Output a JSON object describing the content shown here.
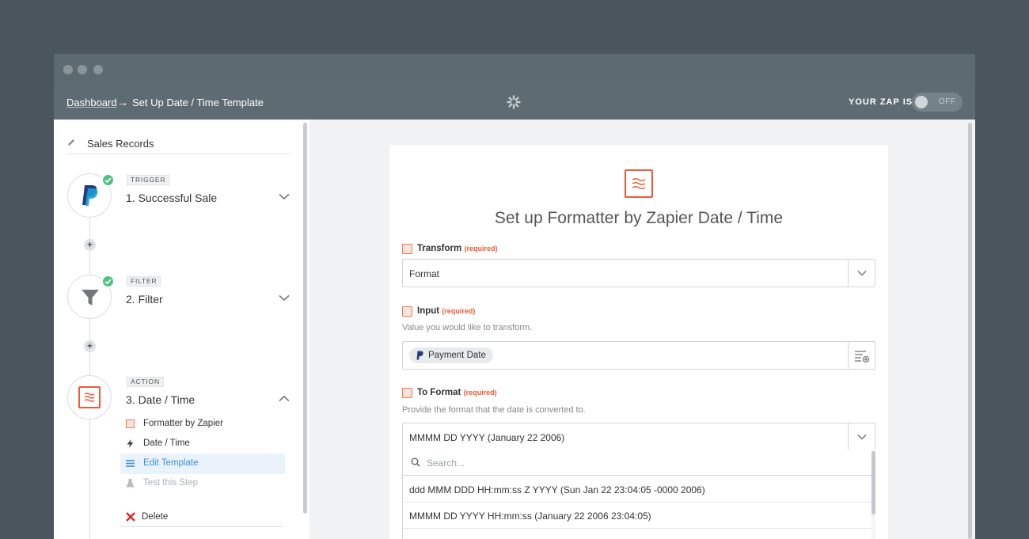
{
  "nav": {
    "breadcrumb_link": "Dashboard",
    "breadcrumb_arrow": "→",
    "breadcrumb_current": "Set Up Date / Time Template",
    "zap_status_label": "YOUR ZAP IS",
    "toggle_text": "OFF"
  },
  "sidebar": {
    "zap_name": "Sales Records",
    "steps": [
      {
        "tag": "TRIGGER",
        "title": "1. Successful Sale",
        "icon": "paypal-icon",
        "completed": true
      },
      {
        "tag": "FILTER",
        "title": "2. Filter",
        "icon": "filter-icon",
        "completed": true
      },
      {
        "tag": "ACTION",
        "title": "3. Date / Time",
        "icon": "formatter-icon",
        "completed": false
      }
    ],
    "add_step": "+",
    "substeps": [
      {
        "label": "Formatter by Zapier",
        "icon": "formatter-icon"
      },
      {
        "label": "Date / Time",
        "icon": "bolt-icon"
      },
      {
        "label": "Edit Template",
        "icon": "list-icon"
      },
      {
        "label": "Test this Step",
        "icon": "flask-icon"
      }
    ],
    "delete_label": "Delete"
  },
  "main": {
    "card_title": "Set up Formatter by Zapier Date / Time",
    "transform": {
      "label": "Transform",
      "required": "(required)",
      "value": "Format"
    },
    "input": {
      "label": "Input",
      "required": "(required)",
      "help": "Value you would like to transform.",
      "pill": "Payment Date"
    },
    "to_format": {
      "label": "To Format",
      "required": "(required)",
      "help": "Provide the format that the date is converted to.",
      "value": "MMMM DD YYYY (January 22 2006)",
      "search_placeholder": "Search...",
      "options": [
        "ddd MMM DDD HH:mm:ss Z YYYY (Sun Jan 22 23:04:05 -0000 2006)",
        "MMMM DD YYYY HH:mm:ss (January 22 2006 23:04:05)"
      ]
    }
  },
  "colors": {
    "accent": "#ee5a35",
    "success": "#4fc180",
    "link": "#3b8ed8",
    "page_bg": "#4a555d"
  }
}
